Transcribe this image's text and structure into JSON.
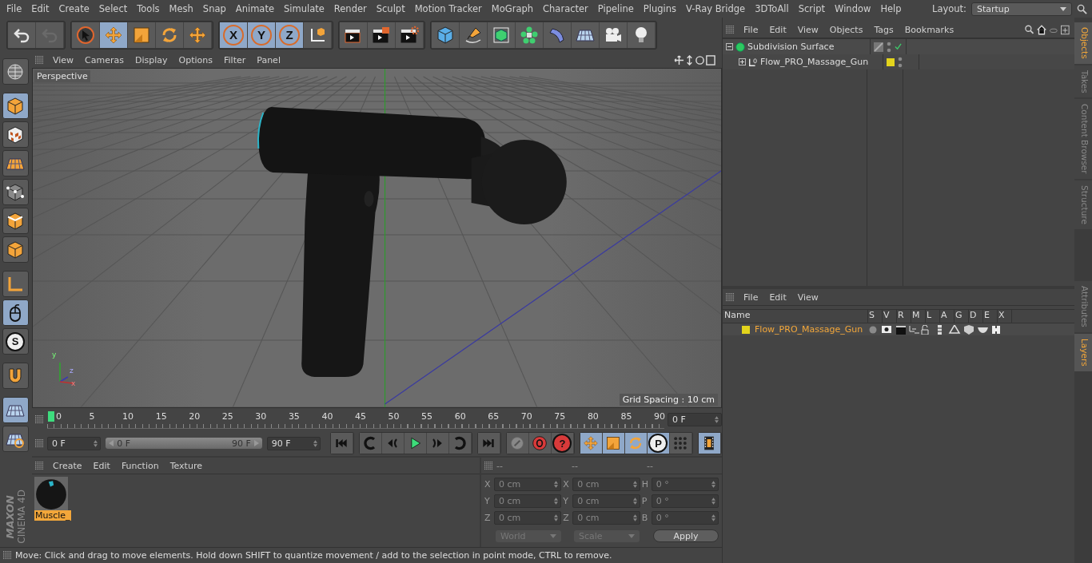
{
  "menu_bar": {
    "items": [
      "File",
      "Edit",
      "Create",
      "Select",
      "Tools",
      "Mesh",
      "Snap",
      "Animate",
      "Simulate",
      "Render",
      "Sculpt",
      "Motion Tracker",
      "MoGraph",
      "Character",
      "Pipeline",
      "Plugins",
      "V-Ray Bridge",
      "3DToAll",
      "Script",
      "Window",
      "Help"
    ],
    "layout": {
      "label": "Layout:",
      "value": "Startup"
    }
  },
  "toolbar": {
    "groups": [
      [
        {
          "kind": "undo",
          "selected": false
        },
        {
          "kind": "redo",
          "selected": false
        }
      ],
      [
        {
          "kind": "select",
          "selected": false
        },
        {
          "kind": "move",
          "selected": true
        },
        {
          "kind": "scale",
          "selected": false
        },
        {
          "kind": "rotate",
          "selected": false
        },
        {
          "kind": "move",
          "selected": false
        }
      ],
      [
        {
          "kind": "axis",
          "label": "X",
          "selected": true
        },
        {
          "kind": "axis",
          "label": "Y",
          "selected": true
        },
        {
          "kind": "axis",
          "label": "Z",
          "selected": true
        },
        {
          "kind": "coords",
          "selected": false
        }
      ],
      [
        {
          "kind": "render-view",
          "selected": false
        },
        {
          "kind": "render-picture",
          "selected": false
        },
        {
          "kind": "render-settings",
          "selected": false
        }
      ],
      [
        {
          "kind": "cube",
          "selected": false
        },
        {
          "kind": "pen",
          "selected": false
        },
        {
          "kind": "subdiv",
          "selected": false
        },
        {
          "kind": "cloner",
          "selected": false
        },
        {
          "kind": "deformer",
          "selected": false
        },
        {
          "kind": "floor",
          "selected": false
        },
        {
          "kind": "camera",
          "selected": false
        },
        {
          "kind": "light",
          "selected": false
        }
      ]
    ]
  },
  "left_tools": [
    {
      "kind": "sphere-grid",
      "selected": false
    },
    {
      "kind": "model",
      "selected": true
    },
    {
      "kind": "texture",
      "selected": false
    },
    {
      "kind": "plane-grid",
      "selected": false
    },
    {
      "kind": "points",
      "selected": false
    },
    {
      "kind": "edges",
      "selected": false
    },
    {
      "kind": "polygons",
      "selected": false
    },
    {
      "kind": "axis-l",
      "selected": false
    },
    {
      "kind": "mouse",
      "selected": true
    },
    {
      "kind": "letter",
      "label": "S",
      "selected": false
    },
    {
      "kind": "magnet",
      "selected": false
    },
    {
      "kind": "workplane",
      "selected": true
    },
    {
      "kind": "lock-grid",
      "selected": false
    }
  ],
  "brand": {
    "maker": "MAXON",
    "product": "CINEMA 4D"
  },
  "viewport": {
    "menu": [
      "View",
      "Cameras",
      "Display",
      "Options",
      "Filter",
      "Panel"
    ],
    "camera": "Perspective",
    "grid_spacing": "Grid Spacing : 10 cm",
    "axis_labels": [
      "y",
      "z",
      "x"
    ]
  },
  "timeline": {
    "ticks": [
      "0",
      "5",
      "10",
      "15",
      "20",
      "25",
      "30",
      "35",
      "40",
      "45",
      "50",
      "55",
      "60",
      "65",
      "70",
      "75",
      "80",
      "85",
      "90"
    ],
    "playhead": {
      "level": 0
    },
    "current_frame": "0 F",
    "start": "0 F",
    "range": {
      "level": 1
    },
    "range_start": "0 F",
    "range_end": "90 F",
    "end": "90 F",
    "transport": [
      {
        "kind": "first"
      },
      {
        "kind": "prev-key"
      },
      {
        "kind": "step-back"
      },
      {
        "kind": "play"
      },
      {
        "kind": "step-forward"
      },
      {
        "kind": "next-key"
      },
      {
        "kind": "last"
      }
    ],
    "keys": [
      {
        "kind": "key-off"
      },
      {
        "kind": "record"
      },
      {
        "kind": "letter",
        "label": "?"
      }
    ],
    "modes": [
      {
        "kind": "move",
        "selected": true
      },
      {
        "kind": "scale",
        "selected": true
      },
      {
        "kind": "rotate",
        "selected": true
      },
      {
        "kind": "letter",
        "label": "P",
        "selected": true
      },
      {
        "kind": "dots",
        "selected": false
      }
    ],
    "film": {
      "kind": "film",
      "selected": true
    }
  },
  "materials": {
    "menu": [
      "Create",
      "Edit",
      "Function",
      "Texture"
    ],
    "items": [
      {
        "name": "Muscle_",
        "selected": true
      }
    ]
  },
  "coordinates": {
    "headers": [
      "--",
      "--",
      "--"
    ],
    "columns": [
      [
        {
          "axis": "X",
          "value": "0 cm"
        },
        {
          "axis": "Y",
          "value": "0 cm"
        },
        {
          "axis": "Z",
          "value": "0 cm"
        }
      ],
      [
        {
          "axis": "X",
          "value": "0 cm"
        },
        {
          "axis": "Y",
          "value": "0 cm"
        },
        {
          "axis": "Z",
          "value": "0 cm"
        }
      ],
      [
        {
          "axis": "H",
          "value": "0 °"
        },
        {
          "axis": "P",
          "value": "0 °"
        },
        {
          "axis": "B",
          "value": "0 °"
        }
      ]
    ],
    "dropdowns": [
      "World",
      "Scale"
    ],
    "apply": "Apply"
  },
  "status_bar": "Move: Click and drag to move elements. Hold down SHIFT to quantize movement / add to the selection in point mode, CTRL to remove.",
  "objects_panel": {
    "menu": [
      "File",
      "Edit",
      "View",
      "Objects",
      "Tags",
      "Bookmarks"
    ],
    "tree": [
      {
        "name": "Subdivision Surface",
        "kind": "subdiv",
        "expanded": true,
        "enabled": true,
        "children": [
          {
            "name": "Flow_PRO_Massage_Gun",
            "kind": "null",
            "expanded": false,
            "color": "#e3d41c"
          }
        ]
      }
    ]
  },
  "layers_panel": {
    "menu": [
      "File",
      "Edit",
      "View"
    ],
    "columns": [
      "Name",
      "S",
      "V",
      "R",
      "M",
      "L",
      "A",
      "G",
      "D",
      "E",
      "X"
    ],
    "layers": [
      {
        "name": "Flow_PRO_Massage_Gun",
        "color": "#e3d41c"
      }
    ]
  },
  "side_tabs_top": [
    {
      "label": "Objects",
      "selected": true
    },
    {
      "label": "Takes",
      "selected": false
    },
    {
      "label": "Content Browser",
      "selected": false
    },
    {
      "label": "Structure",
      "selected": false
    }
  ],
  "side_tabs_bottom": [
    {
      "label": "Attributes",
      "selected": false
    },
    {
      "label": "Layers",
      "selected": true
    }
  ]
}
